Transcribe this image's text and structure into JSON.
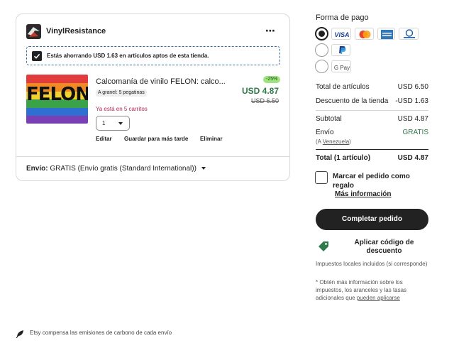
{
  "shop": {
    "name": "VinylResistance",
    "more_icon": "⋯",
    "savings_text": "Estás ahorrando USD 1.63 en artículos aptos de esta tienda."
  },
  "item": {
    "image_text": "FELON",
    "title": "Calcomanía de vinilo FELON: calco...",
    "bulk_badge": "A granel: 5 pegatinas",
    "in_carts": "Ya está en 5 carritos",
    "quantity": "1",
    "discount": "-25%",
    "price": "USD 4.87",
    "old_price": "USD 6.50",
    "actions": {
      "edit": "Editar",
      "save_later": "Guardar para más tarde",
      "remove": "Eliminar"
    }
  },
  "shipping": {
    "label": "Envío:",
    "value": "GRATIS (Envío gratis (Standard International))"
  },
  "payment": {
    "title": "Forma de pago",
    "methods": [
      "VISA",
      "mastercard",
      "AMEX",
      "Diners Club",
      "PayPal",
      "G Pay"
    ],
    "selected": "cards"
  },
  "summary": {
    "total_items_label": "Total de artículos",
    "total_items_value": "USD 6.50",
    "shop_discount_label": "Descuento de la tienda",
    "shop_discount_value": "-USD 1.63",
    "subtotal_label": "Subtotal",
    "subtotal_value": "USD 4.87",
    "shipping_label": "Envío",
    "shipping_value": "GRATIS",
    "shipping_dest_prefix": "(A ",
    "shipping_dest": "Venezuela",
    "shipping_dest_suffix": ")",
    "total_label": "Total (1 artículo)",
    "total_value": "USD 4.87"
  },
  "gift": {
    "label": "Marcar el pedido como regalo",
    "more_info": "Más información"
  },
  "complete_button": "Completar pedido",
  "coupon_label": "Aplicar código de descuento",
  "taxes_note": "Impuestos locales incluidos (si corresponde)",
  "duties_note_prefix": "* Obtén más información sobre los impuestos, los aranceles y las tasas adicionales que ",
  "duties_note_link": "pueden aplicarse",
  "footer_text": "Etsy compensa las emisiones de carbono de cada envío",
  "colors": {
    "price_green": "#2f7a4a",
    "discount_pill": "#9ee37d",
    "in_carts": "#b3265a",
    "button": "#222222"
  }
}
